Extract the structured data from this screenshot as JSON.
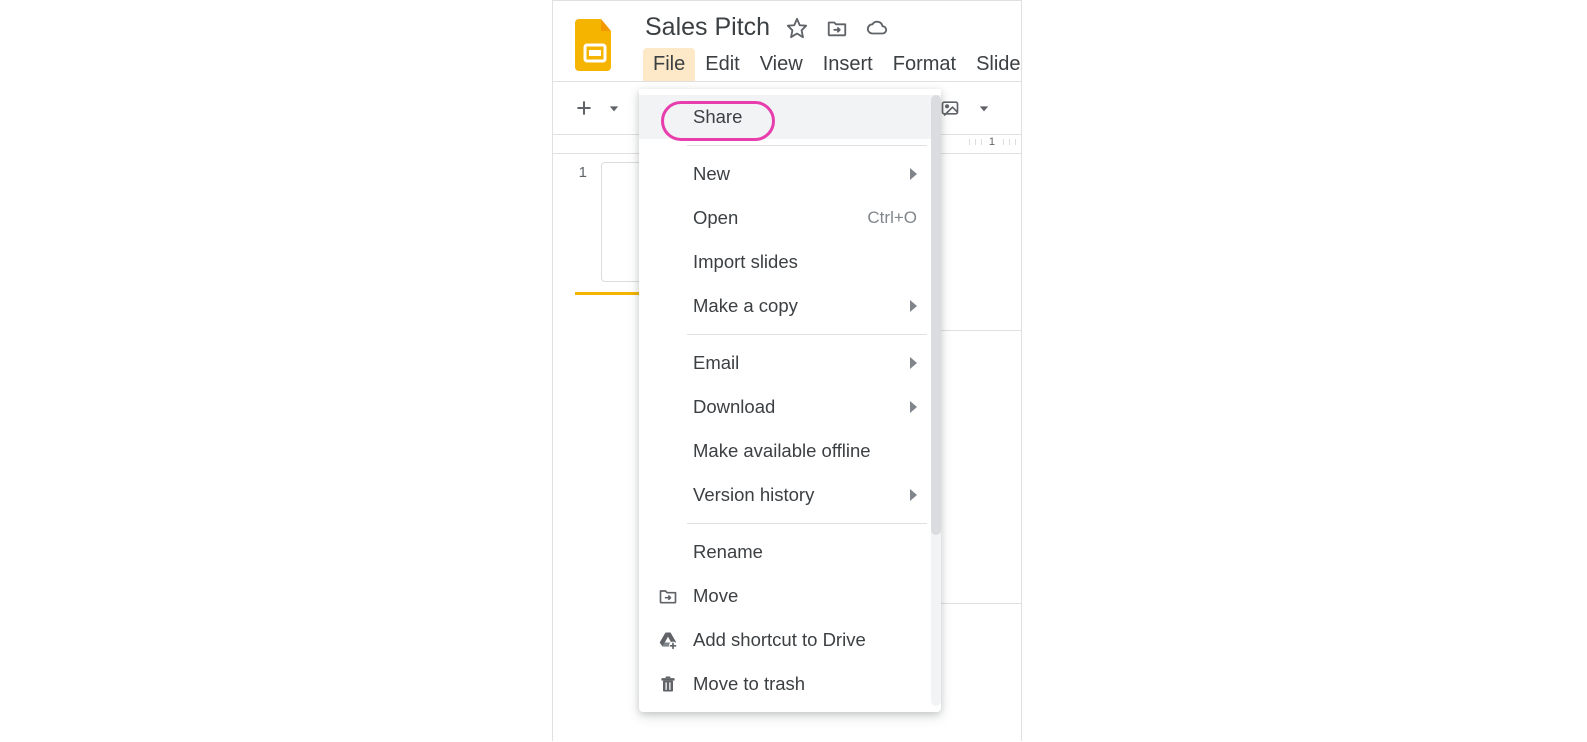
{
  "doc": {
    "title": "Sales Pitch"
  },
  "menubar": {
    "items": [
      {
        "label": "File",
        "active": true
      },
      {
        "label": "Edit",
        "active": false
      },
      {
        "label": "View",
        "active": false
      },
      {
        "label": "Insert",
        "active": false
      },
      {
        "label": "Format",
        "active": false
      },
      {
        "label": "Slide",
        "active": false
      }
    ]
  },
  "ruler": {
    "visible_mark": "1"
  },
  "slide_panel": {
    "slides": [
      {
        "number": "1"
      }
    ]
  },
  "file_menu": {
    "items": [
      {
        "label": "Share",
        "icon": "",
        "shortcut": "",
        "submenu": false,
        "hovered": true,
        "highlighted": true
      },
      {
        "sep": true
      },
      {
        "label": "New",
        "icon": "",
        "shortcut": "",
        "submenu": true
      },
      {
        "label": "Open",
        "icon": "",
        "shortcut": "Ctrl+O",
        "submenu": false
      },
      {
        "label": "Import slides",
        "icon": "",
        "shortcut": "",
        "submenu": false
      },
      {
        "label": "Make a copy",
        "icon": "",
        "shortcut": "",
        "submenu": true
      },
      {
        "sep": true
      },
      {
        "label": "Email",
        "icon": "",
        "shortcut": "",
        "submenu": true
      },
      {
        "label": "Download",
        "icon": "",
        "shortcut": "",
        "submenu": true
      },
      {
        "label": "Make available offline",
        "icon": "",
        "shortcut": "",
        "submenu": false
      },
      {
        "label": "Version history",
        "icon": "",
        "shortcut": "",
        "submenu": true
      },
      {
        "sep": true
      },
      {
        "label": "Rename",
        "icon": "",
        "shortcut": "",
        "submenu": false
      },
      {
        "label": "Move",
        "icon": "move-icon",
        "shortcut": "",
        "submenu": false
      },
      {
        "label": "Add shortcut to Drive",
        "icon": "drive-icon",
        "shortcut": "",
        "submenu": false
      },
      {
        "label": "Move to trash",
        "icon": "trash-icon",
        "shortcut": "",
        "submenu": false
      }
    ]
  }
}
